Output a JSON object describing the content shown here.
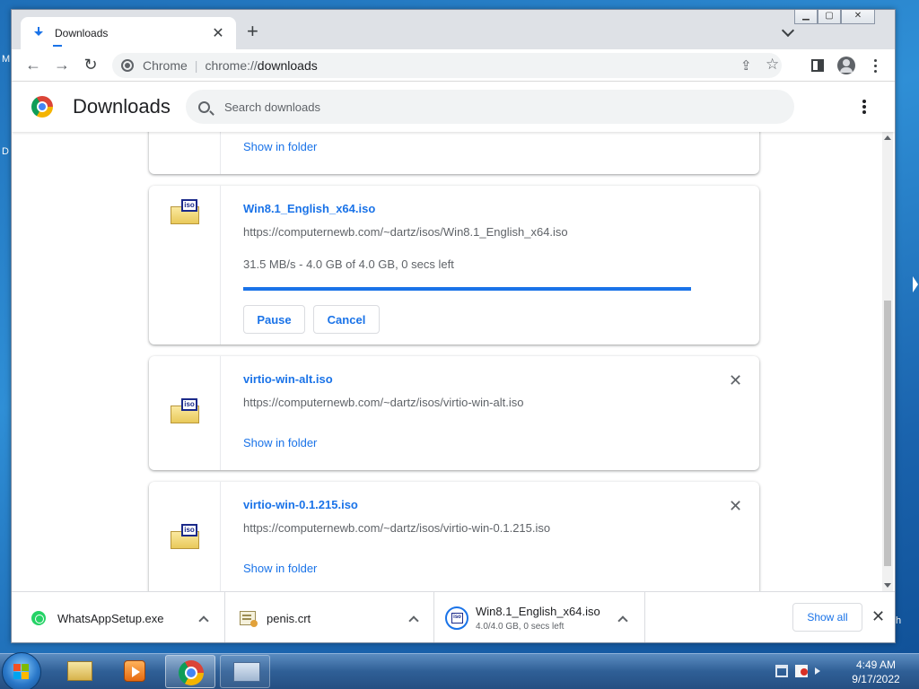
{
  "browser": {
    "tab": {
      "title": "Downloads",
      "close_glyph": "✕",
      "icon": "download-icon"
    },
    "newtab_glyph": "+",
    "window_buttons": {
      "minimize": "▁",
      "maximize": "▢",
      "close": "✕"
    },
    "omnibox": {
      "site_label": "Chrome",
      "scheme": "chrome://",
      "path": "downloads"
    },
    "nav": {
      "back": "←",
      "forward": "→",
      "reload": "↻"
    },
    "toolbar_icons": {
      "share": "⇪",
      "bookmark": "☆"
    }
  },
  "page": {
    "title": "Downloads",
    "search_placeholder": "Search downloads"
  },
  "downloads": [
    {
      "link": "Show in folder"
    },
    {
      "name": "Win8.1_English_x64.iso",
      "url": "https://computernewb.com/~dartz/isos/Win8.1_English_x64.iso",
      "status": "31.5 MB/s - 4.0 GB of 4.0 GB, 0 secs left",
      "progress": 1.0,
      "pause": "Pause",
      "cancel": "Cancel"
    },
    {
      "name": "virtio-win-alt.iso",
      "url": "https://computernewb.com/~dartz/isos/virtio-win-alt.iso",
      "link": "Show in folder",
      "close": "✕"
    },
    {
      "name": "virtio-win-0.1.215.iso",
      "url": "https://computernewb.com/~dartz/isos/virtio-win-0.1.215.iso",
      "link": "Show in folder",
      "close": "✕"
    }
  ],
  "iso_label": "iso",
  "shelf": {
    "items": [
      {
        "name": "WhatsAppSetup.exe"
      },
      {
        "name": "penis.crt"
      },
      {
        "name": "Win8.1_English_x64.iso",
        "sub": "4.0/4.0 GB, 0 secs left"
      }
    ],
    "show_all": "Show all",
    "close": "✕"
  },
  "desktop": {
    "letters": [
      "M",
      "D"
    ],
    "right_stub": "h"
  },
  "taskbar": {
    "time": "4:49 AM",
    "date": "9/17/2022"
  },
  "colors": {
    "accent": "#1a73e8",
    "taskbar": "#2f5f96"
  }
}
